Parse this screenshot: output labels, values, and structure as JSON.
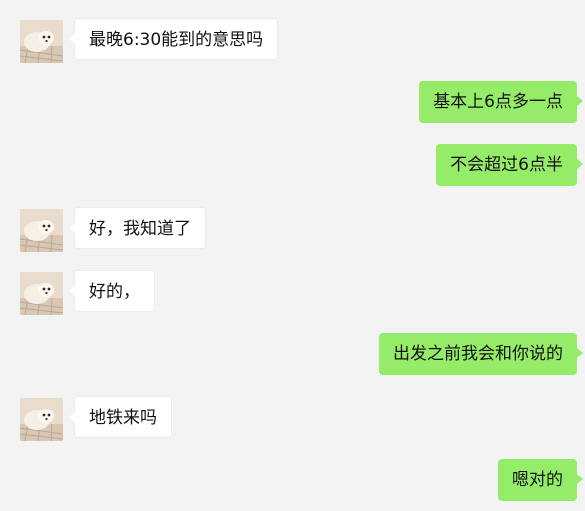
{
  "chat": {
    "background_color": "#f3f3f3",
    "incoming_bubble_color": "#ffffff",
    "outgoing_bubble_color": "#95ec69",
    "messages": [
      {
        "direction": "incoming",
        "text": "最晚6:30能到的意思吗"
      },
      {
        "direction": "outgoing",
        "text": "基本上6点多一点"
      },
      {
        "direction": "outgoing",
        "text": "不会超过6点半"
      },
      {
        "direction": "incoming",
        "text": "好，我知道了"
      },
      {
        "direction": "incoming",
        "text": "好的，"
      },
      {
        "direction": "outgoing",
        "text": "出发之前我会和你说的"
      },
      {
        "direction": "incoming",
        "text": "地铁来吗"
      },
      {
        "direction": "outgoing",
        "text": "嗯对的"
      }
    ]
  }
}
